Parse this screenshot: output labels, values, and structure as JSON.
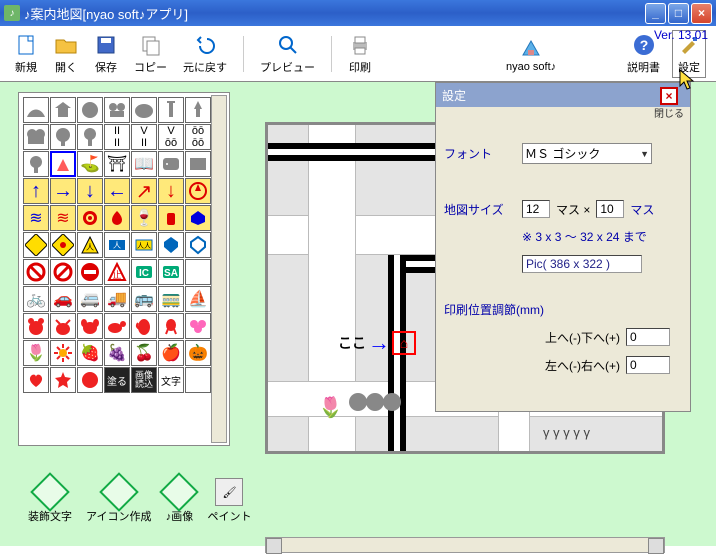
{
  "window": {
    "title": "♪案内地図[nyao soft♪アプリ]",
    "version": "Ver. 13.01"
  },
  "toolbar": {
    "new": "新規",
    "open": "開く",
    "save": "保存",
    "copy": "コピー",
    "undo": "元に戻す",
    "preview": "プレビュー",
    "print": "印刷",
    "nyaolink": "nyao soft♪",
    "manual": "説明書",
    "settings": "設定"
  },
  "bottom": {
    "decotext": "装飾文字",
    "iconmake": "アイコン作成",
    "image": "♪画像",
    "paint": "ペイント"
  },
  "palette_labels": {
    "paint": "塗る",
    "imgload": "画像\n読込",
    "text": "文字"
  },
  "map": {
    "here": "ここ",
    "gamma_marks": "γ γ γ γ γ"
  },
  "settings_panel": {
    "title": "設定",
    "close": "閉じる",
    "font_label": "フォント",
    "font_value": "ＭＳ ゴシック",
    "mapsize_label": "地図サイズ",
    "mapsize_w": "12",
    "mapsize_unit1": "マス ×",
    "mapsize_h": "10",
    "mapsize_unit2": "マス",
    "mapsize_note": "※ 3 x 3 ～ 32 x 24 まで",
    "pic_dims": "Pic( 386 x 322 )",
    "print_label": "印刷位置調節(mm)",
    "print_v_label": "上へ(-)下へ(+)",
    "print_v_value": "0",
    "print_h_label": "左へ(-)右へ(+)",
    "print_h_value": "0"
  }
}
